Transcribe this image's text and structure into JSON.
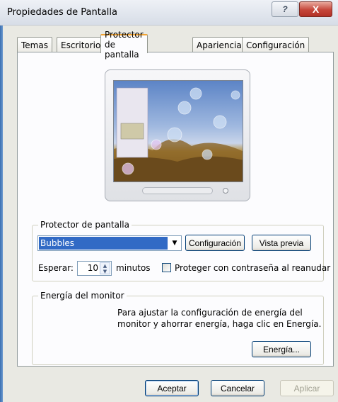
{
  "window": {
    "title": "Propiedades de Pantalla",
    "help_label": "?",
    "close_label": "X"
  },
  "tabs": [
    {
      "label": "Temas"
    },
    {
      "label": "Escritorio"
    },
    {
      "label": "Protector de pantalla",
      "active": true
    },
    {
      "label": "Apariencia"
    },
    {
      "label": "Configuración"
    }
  ],
  "screensaver": {
    "group_label": "Protector de pantalla",
    "selected": "Bubbles",
    "settings_button": "Configuración",
    "preview_button": "Vista previa",
    "wait_label": "Esperar:",
    "wait_value": "10",
    "minutes_label": "minutos",
    "password_label": "Proteger con contraseña al reanudar"
  },
  "energy": {
    "group_label": "Energía del monitor",
    "description": "Para ajustar la configuración de energía del monitor y ahorrar energía, haga clic en Energía.",
    "button": "Energía..."
  },
  "footer": {
    "ok": "Aceptar",
    "cancel": "Cancelar",
    "apply": "Aplicar"
  }
}
